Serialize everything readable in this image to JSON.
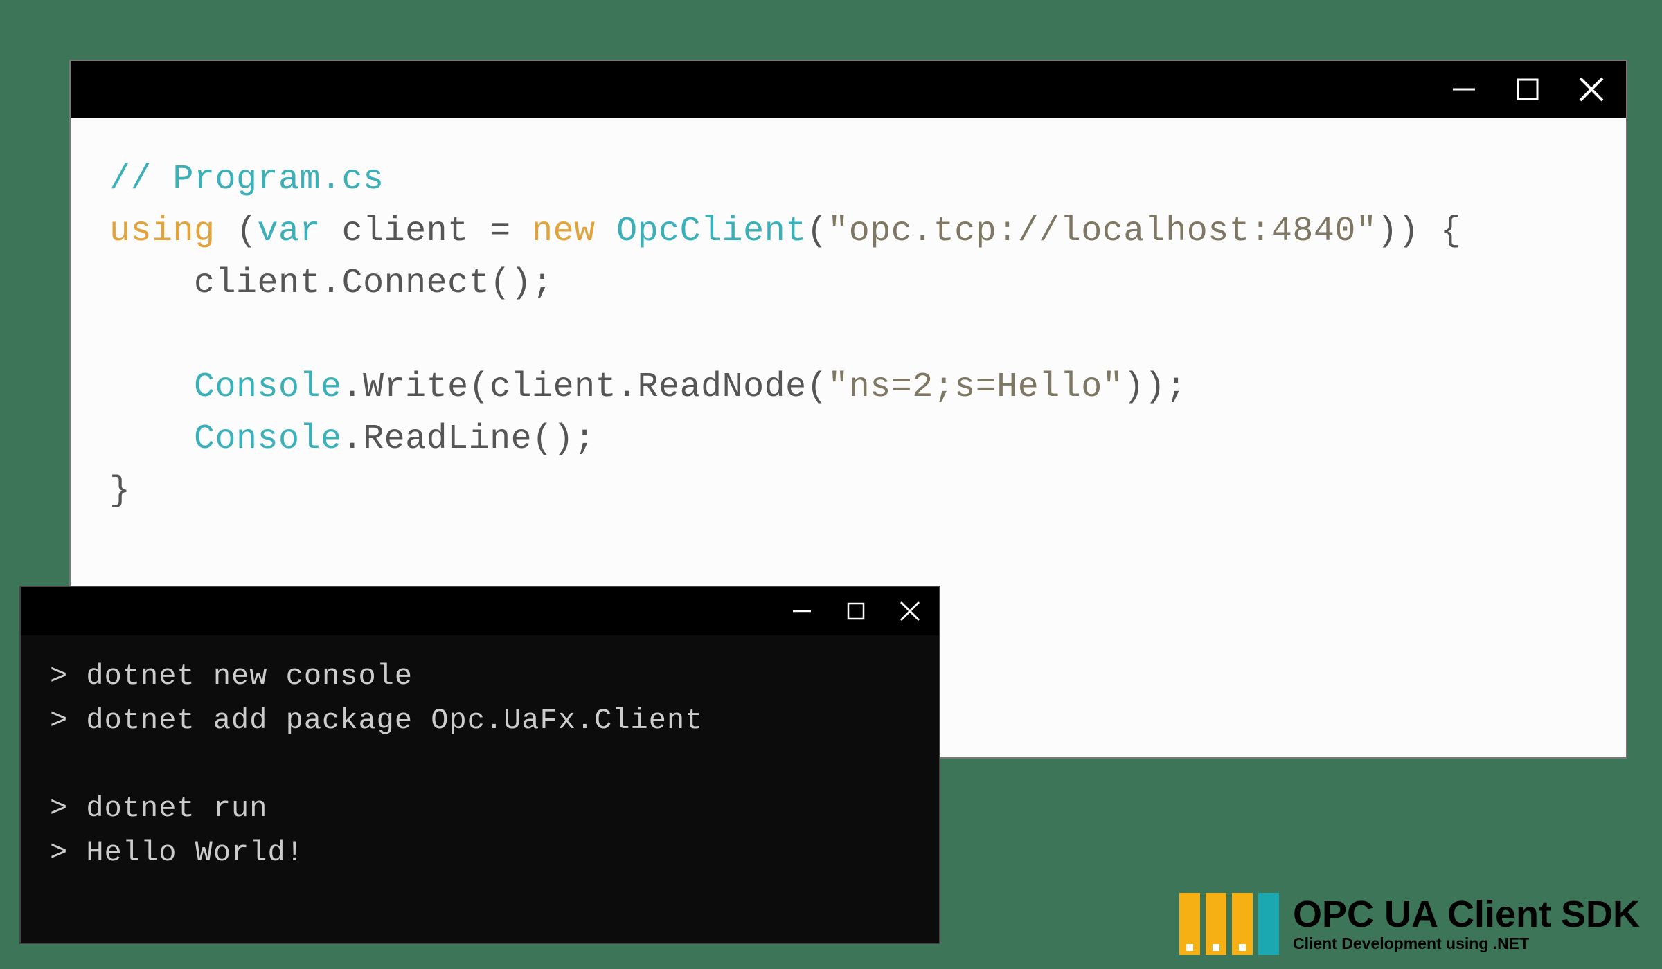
{
  "editor": {
    "code": {
      "line1_comment": "// Program.cs",
      "line2_using": "using",
      "line2_open": " (",
      "line2_var": "var",
      "line2_client_eq": " client = ",
      "line2_new": "new",
      "line2_space": " ",
      "line2_type": "OpcClient",
      "line2_paren": "(",
      "line2_str": "\"opc.tcp://localhost:4840\"",
      "line2_end": ")) {",
      "line3_indent": "    ",
      "line3_text": "client.Connect();",
      "line5_indent": "    ",
      "line5_console": "Console",
      "line5_rest1": ".Write(client.ReadNode(",
      "line5_str": "\"ns=2;s=Hello\"",
      "line5_rest2": "));",
      "line6_indent": "    ",
      "line6_console": "Console",
      "line6_rest": ".ReadLine();",
      "line7_close": "}"
    }
  },
  "terminal": {
    "line1": "> dotnet new console",
    "line2": "> dotnet add package Opc.UaFx.Client",
    "line4": "> dotnet run",
    "line5": "> Hello World!"
  },
  "logo": {
    "main": "OPC UA Client",
    "sdk": "SDK",
    "sub": "Client Development using .NET"
  }
}
